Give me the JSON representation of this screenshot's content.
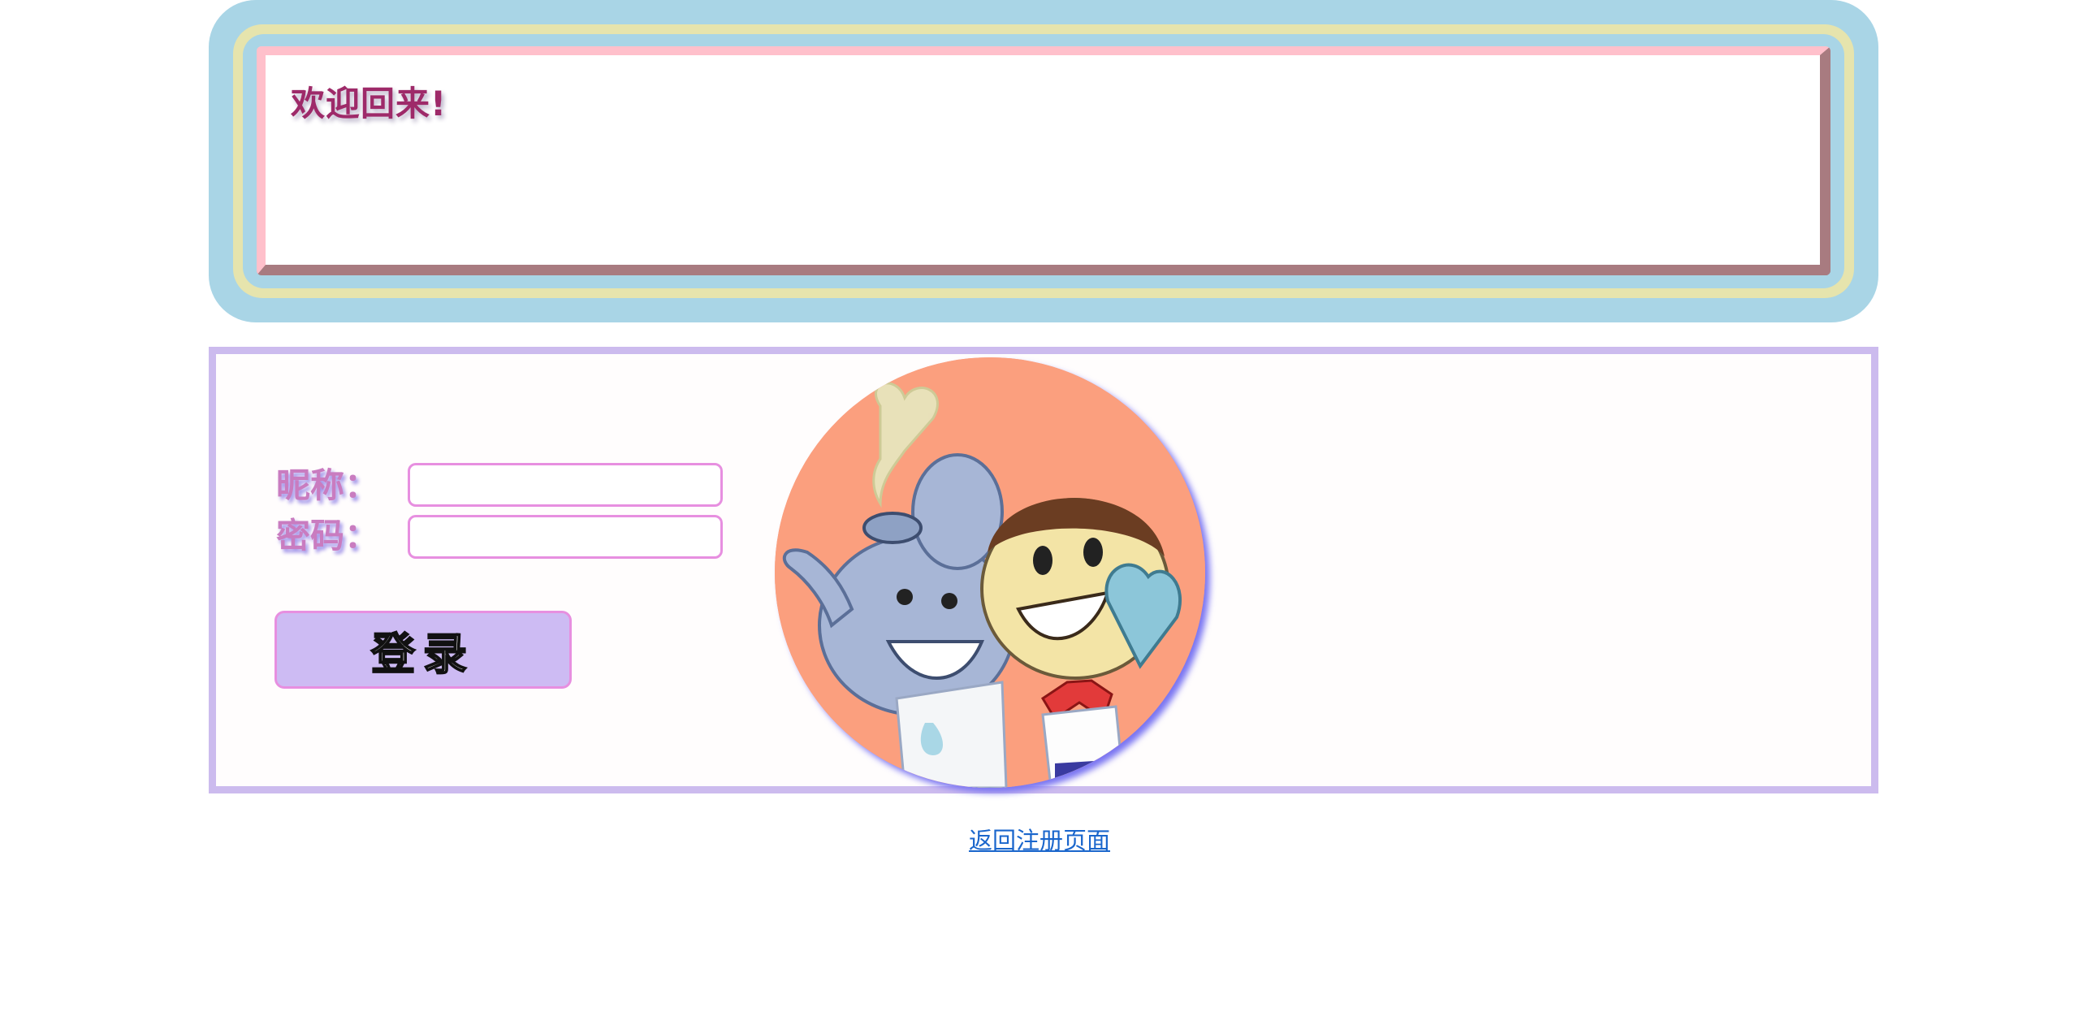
{
  "header": {
    "welcome_text": "欢迎回来!"
  },
  "login": {
    "nickname_label": "昵称：",
    "nickname_value": "",
    "password_label": "密码：",
    "password_value": "",
    "login_button": "登录"
  },
  "avatar": {
    "icon": "cartoon-teapot-and-kid-illustration"
  },
  "footer": {
    "back_link": "返回注册页面"
  },
  "colors": {
    "header_outer": "#a9d5e6",
    "header_ring": "#e6e4ad",
    "card_light_border": "#ffc0cb",
    "card_dark_border": "#a87b80",
    "welcome_text": "#9e2a69",
    "panel_border": "#ccbbee",
    "input_border": "#e78fe0",
    "button_bg": "#cdbbf3",
    "link": "#1a66cc"
  }
}
